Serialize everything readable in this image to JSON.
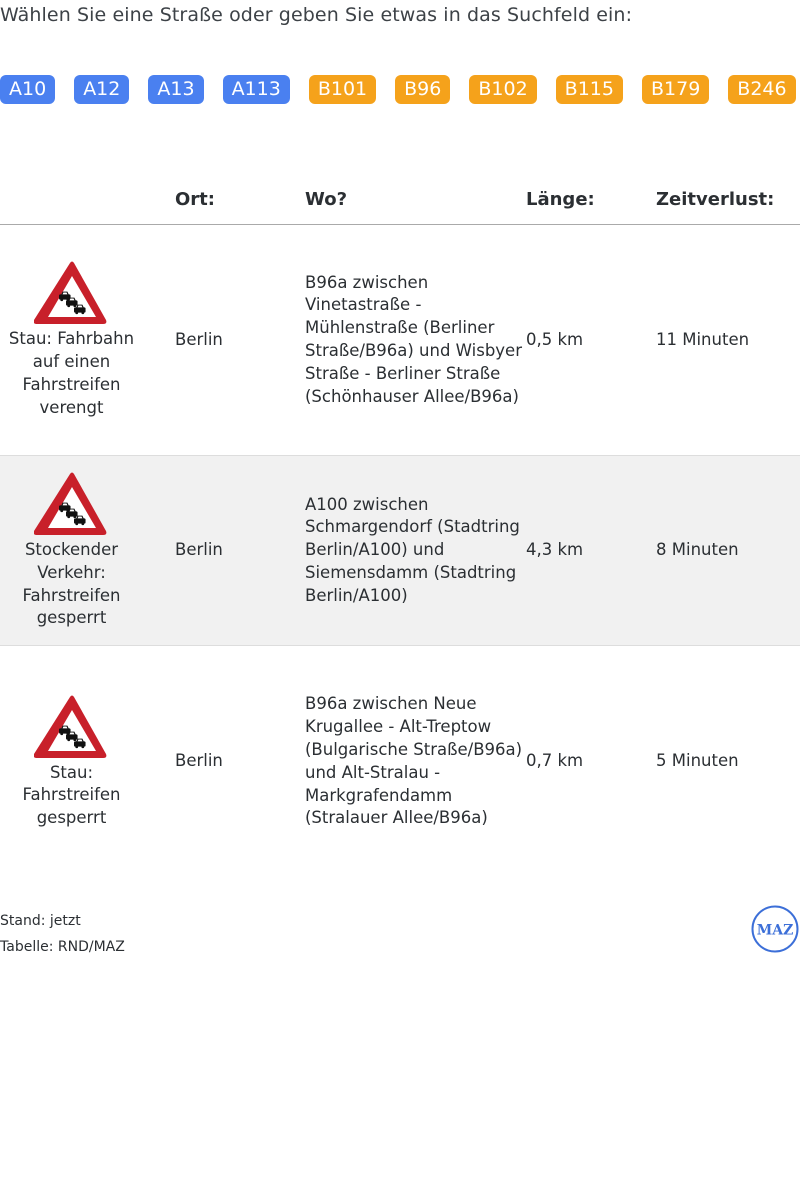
{
  "prompt": "Wählen Sie eine Straße oder geben Sie etwas in das Suchfeld ein:",
  "roads": [
    {
      "label": "A10",
      "type": "blue"
    },
    {
      "label": "A12",
      "type": "blue"
    },
    {
      "label": "A13",
      "type": "blue"
    },
    {
      "label": "A113",
      "type": "blue"
    },
    {
      "label": "B101",
      "type": "orange"
    },
    {
      "label": "B96",
      "type": "orange"
    },
    {
      "label": "B102",
      "type": "orange"
    },
    {
      "label": "B115",
      "type": "orange"
    },
    {
      "label": "B179",
      "type": "orange"
    },
    {
      "label": "B246",
      "type": "orange"
    }
  ],
  "colors": {
    "autobahn_chip": "#4a80f0",
    "bundesstrasse_chip": "#f5a21b",
    "warning_red": "#c8202a",
    "logo_blue": "#3c6fd8"
  },
  "table": {
    "headers": {
      "icon": "",
      "ort": "Ort:",
      "wo": "Wo?",
      "laenge": "Länge:",
      "zeitverlust": "Zeitverlust:"
    },
    "rows": [
      {
        "icon": "traffic-jam-warning-icon",
        "status": "Stau: Fahrbahn auf einen Fahrstreifen verengt",
        "ort": "Berlin",
        "wo": "B96a zwischen Vinetastraße - Mühlenstraße (Berliner Straße/B96a) und Wisbyer Straße - Berliner Straße (Schönhauser Allee/B96a)",
        "laenge": "0,5 km",
        "zeitverlust": "11 Minuten"
      },
      {
        "icon": "traffic-jam-warning-icon",
        "status": "Stockender Verkehr: Fahrstreifen gesperrt",
        "ort": "Berlin",
        "wo": "A100 zwischen Schmargendorf (Stadtring Berlin/A100) und Siemensdamm (Stadtring Berlin/A100)",
        "laenge": "4,3 km",
        "zeitverlust": "8 Minuten"
      },
      {
        "icon": "traffic-jam-warning-icon",
        "status": "Stau: Fahrstreifen gesperrt",
        "ort": "Berlin",
        "wo": "B96a zwischen Neue Krugallee - Alt-Treptow (Bulgarische Straße/B96a) und Alt-Stralau - Markgrafendamm (Stralauer Allee/B96a)",
        "laenge": "0,7 km",
        "zeitverlust": "5 Minuten"
      }
    ]
  },
  "footer": {
    "stand": "Stand: jetzt",
    "source": "Tabelle: RND/MAZ"
  },
  "logo": {
    "icon": "maz-logo-icon",
    "text": "MAZ"
  }
}
